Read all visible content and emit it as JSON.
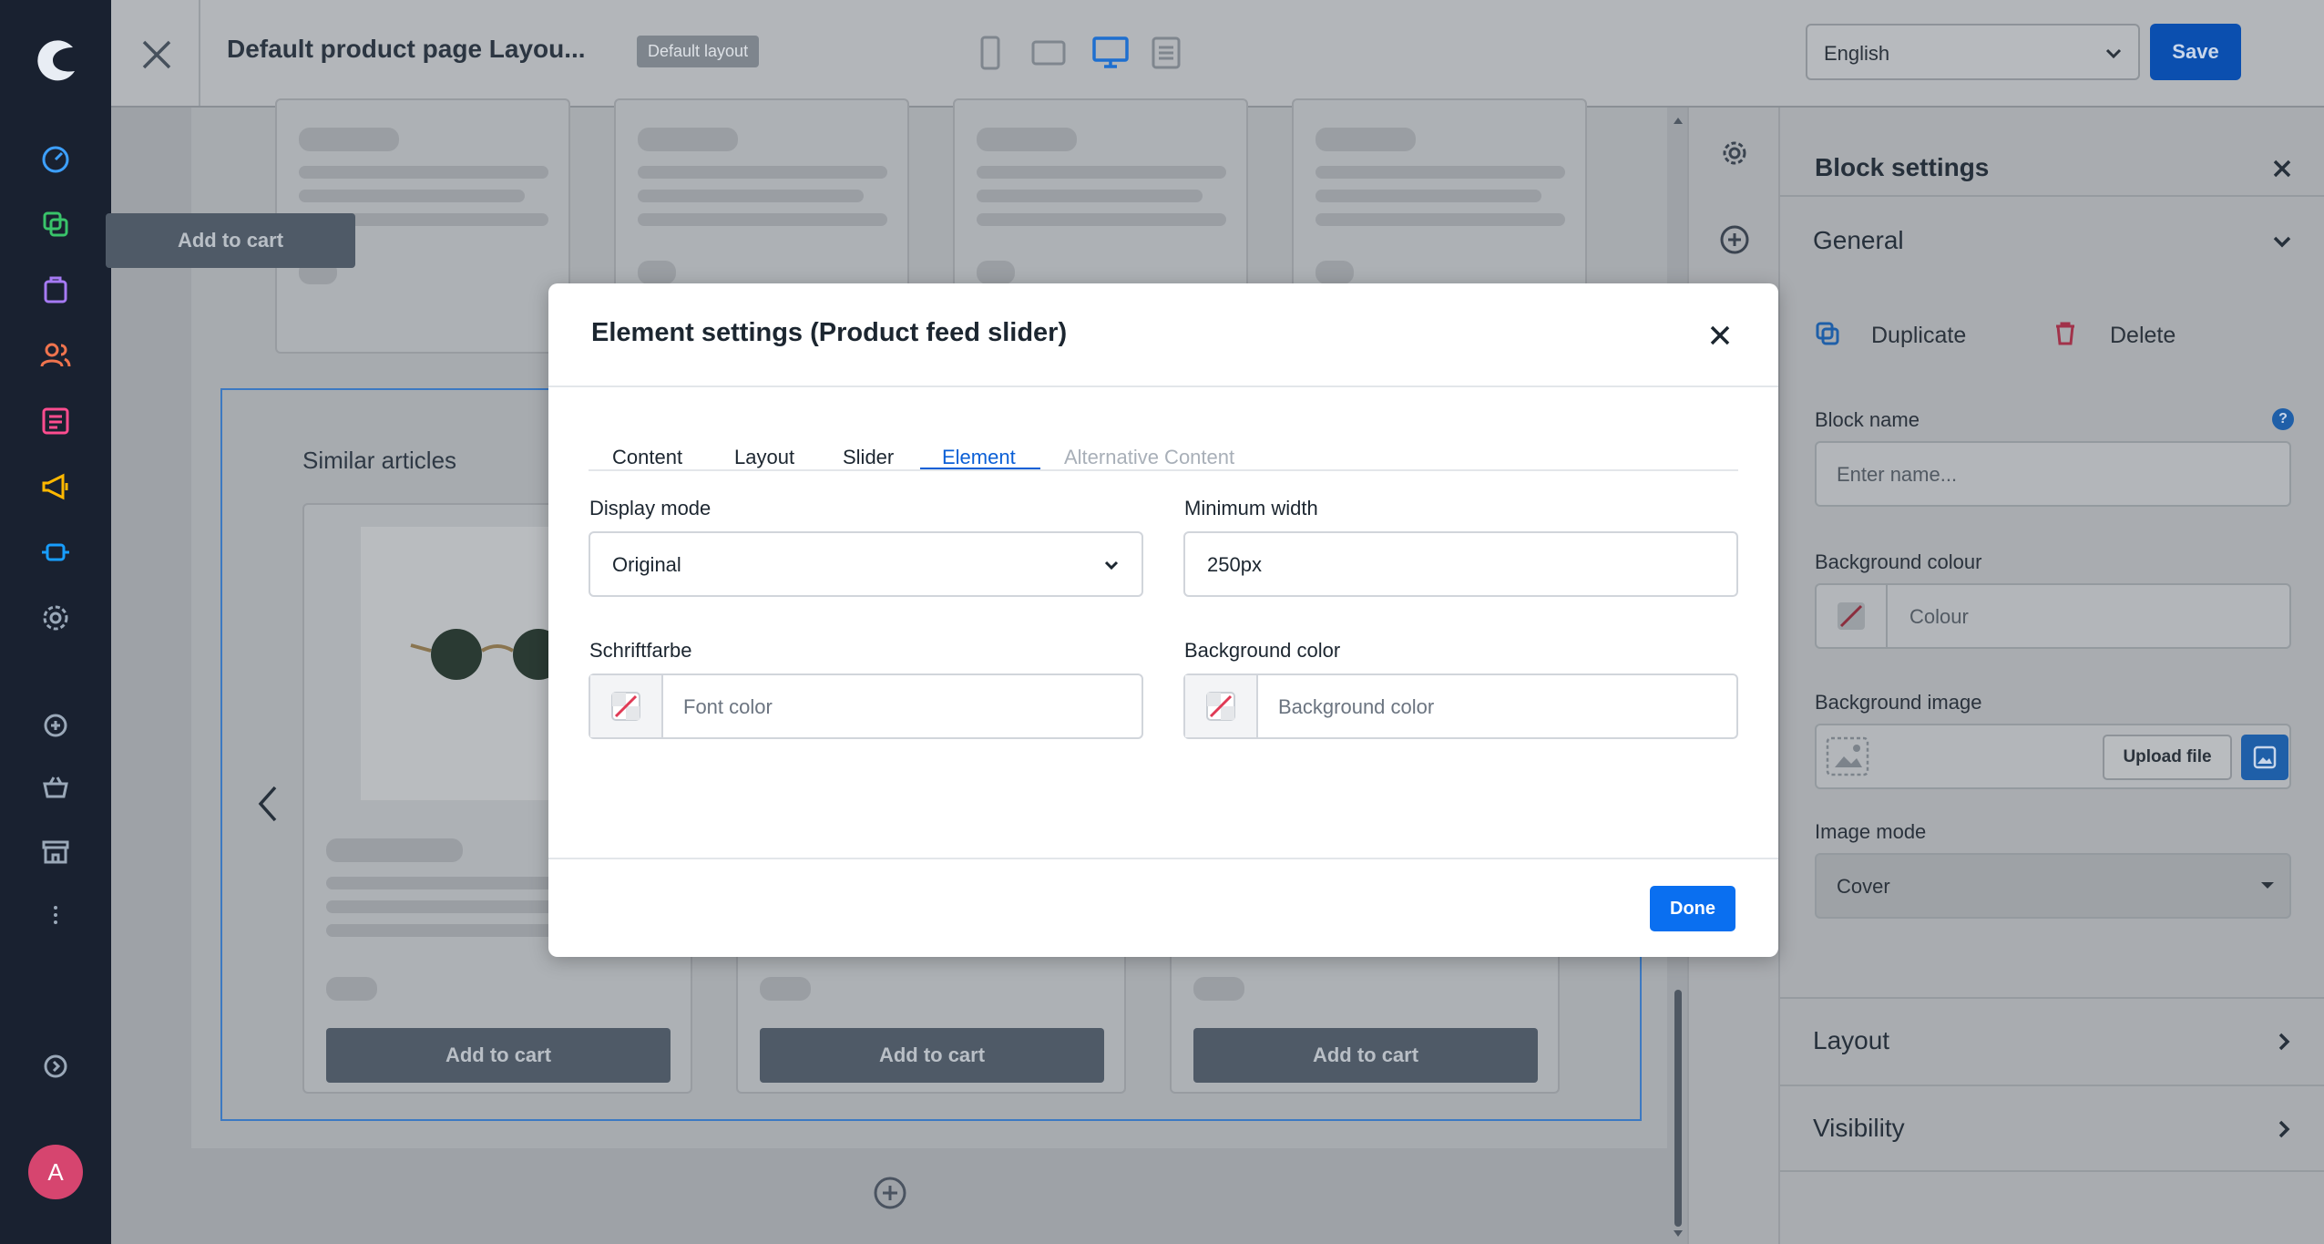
{
  "topbar": {
    "title": "Default product page Layou...",
    "badge": "Default layout",
    "language": "English",
    "save_label": "Save"
  },
  "sidebar": {
    "avatar_initial": "A",
    "items": [
      "dashboard-icon",
      "catalogue-icon",
      "orders-icon",
      "customers-icon",
      "content-icon",
      "marketing-icon",
      "extensions-icon",
      "settings-icon",
      "add-icon",
      "basket-icon",
      "store-icon",
      "more-icon",
      "expand-icon"
    ]
  },
  "canvas": {
    "section_title": "Similar articles",
    "add_to_cart": "Add to cart"
  },
  "panel": {
    "title": "Block settings",
    "general": "General",
    "duplicate": "Duplicate",
    "delete": "Delete",
    "block_name_label": "Block name",
    "block_name_placeholder": "Enter name...",
    "bg_colour_label": "Background colour",
    "bg_colour_placeholder": "Colour",
    "bg_image_label": "Background image",
    "upload_label": "Upload file",
    "image_mode_label": "Image mode",
    "image_mode_value": "Cover",
    "layout": "Layout",
    "visibility": "Visibility"
  },
  "modal": {
    "title": "Element settings (Product feed slider)",
    "tabs": [
      "Content",
      "Layout",
      "Slider",
      "Element",
      "Alternative Content"
    ],
    "active_tab": "Element",
    "display_mode_label": "Display mode",
    "display_mode_value": "Original",
    "min_width_label": "Minimum width",
    "min_width_value": "250px",
    "font_color_label": "Schriftfarbe",
    "font_color_placeholder": "Font color",
    "bg_color_label": "Background color",
    "bg_color_placeholder": "Background color",
    "done_label": "Done"
  },
  "colors": {
    "accent": "#0a5fd6",
    "sidebar_bg": "#192130",
    "avatar": "#d6456f"
  }
}
